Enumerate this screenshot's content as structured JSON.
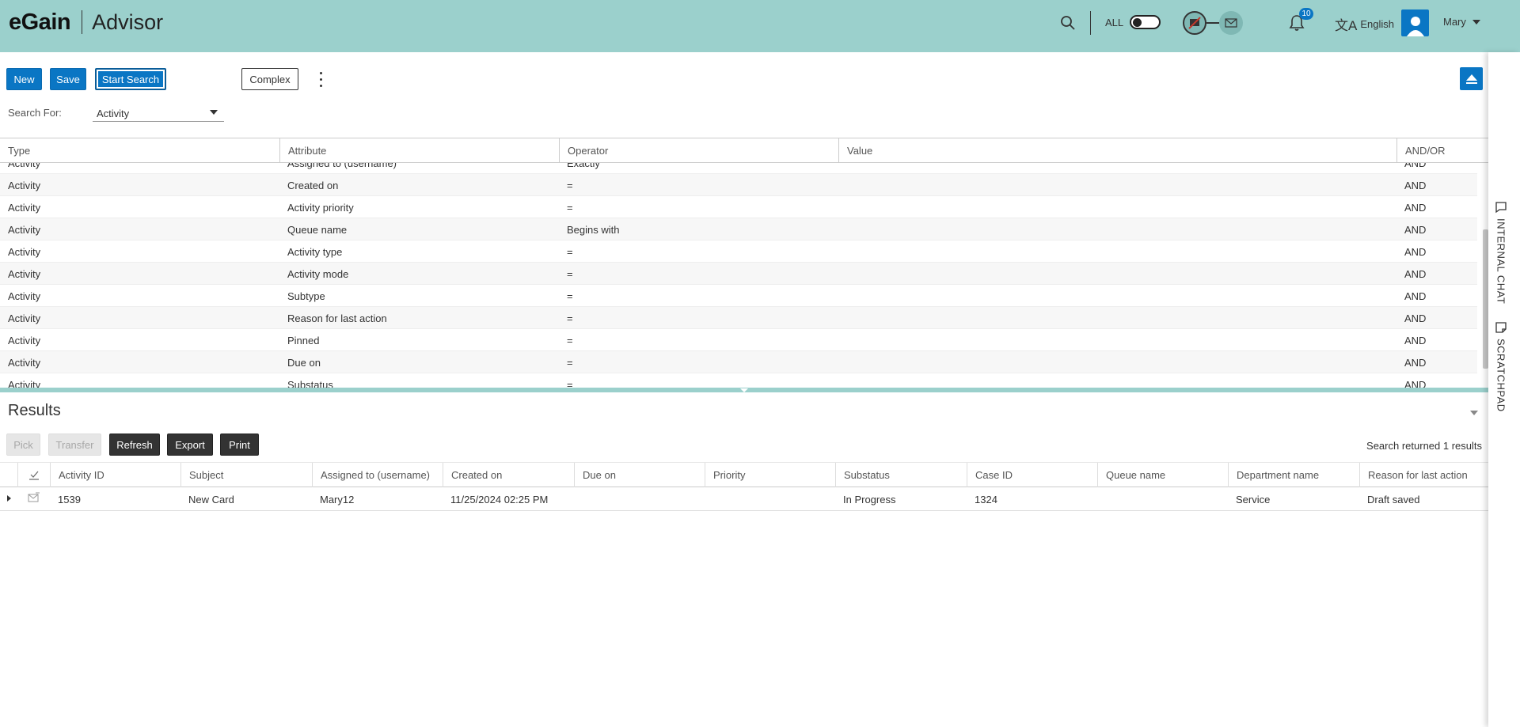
{
  "header": {
    "brand_name": "eGain",
    "product_name": "Advisor",
    "search_scope_label": "ALL",
    "notification_count": "10",
    "language_label": "English",
    "user_name": "Mary"
  },
  "toolbar": {
    "new_label": "New",
    "save_label": "Save",
    "start_search_label": "Start Search",
    "complex_label": "Complex"
  },
  "search_for": {
    "label": "Search For:",
    "selected": "Activity"
  },
  "criteria": {
    "columns": [
      "Type",
      "Attribute",
      "Operator",
      "Value",
      "AND/OR"
    ],
    "rows": [
      {
        "type": "Activity",
        "attribute": "Assigned to (username)",
        "operator": "Exactly",
        "value": "",
        "andor": "AND"
      },
      {
        "type": "Activity",
        "attribute": "Created on",
        "operator": "=",
        "value": "",
        "andor": "AND"
      },
      {
        "type": "Activity",
        "attribute": "Activity priority",
        "operator": "=",
        "value": "",
        "andor": "AND"
      },
      {
        "type": "Activity",
        "attribute": "Queue name",
        "operator": "Begins with",
        "value": "",
        "andor": "AND"
      },
      {
        "type": "Activity",
        "attribute": "Activity type",
        "operator": "=",
        "value": "",
        "andor": "AND"
      },
      {
        "type": "Activity",
        "attribute": "Activity mode",
        "operator": "=",
        "value": "",
        "andor": "AND"
      },
      {
        "type": "Activity",
        "attribute": "Subtype",
        "operator": "=",
        "value": "",
        "andor": "AND"
      },
      {
        "type": "Activity",
        "attribute": "Reason for last action",
        "operator": "=",
        "value": "",
        "andor": "AND"
      },
      {
        "type": "Activity",
        "attribute": "Pinned",
        "operator": "=",
        "value": "",
        "andor": "AND"
      },
      {
        "type": "Activity",
        "attribute": "Due on",
        "operator": "=",
        "value": "",
        "andor": "AND"
      },
      {
        "type": "Activity",
        "attribute": "Substatus",
        "operator": "=",
        "value": "",
        "andor": "AND"
      }
    ]
  },
  "results": {
    "title": "Results",
    "pick_label": "Pick",
    "transfer_label": "Transfer",
    "refresh_label": "Refresh",
    "export_label": "Export",
    "print_label": "Print",
    "summary": "Search returned 1 results",
    "columns": [
      "Activity ID",
      "Subject",
      "Assigned to (username)",
      "Created on",
      "Due on",
      "Priority",
      "Substatus",
      "Case ID",
      "Queue name",
      "Department name",
      "Reason for last action"
    ],
    "rows": [
      {
        "activity_id": "1539",
        "subject": "New Card",
        "assigned_to": "Mary12",
        "created_on": "11/25/2024 02:25 PM",
        "due_on": "",
        "priority": "",
        "substatus": "In Progress",
        "case_id": "1324",
        "queue_name": "",
        "department": "Service",
        "reason": "Draft saved"
      }
    ]
  },
  "sidebar": {
    "internal_chat_label": "INTERNAL CHAT",
    "scratchpad_label": "SCRATCHPAD"
  },
  "colors": {
    "header_bg": "#9bd0cc",
    "primary_blue": "#0a76c4",
    "dark_button": "#333333",
    "notification_badge": "#0a76c4"
  }
}
